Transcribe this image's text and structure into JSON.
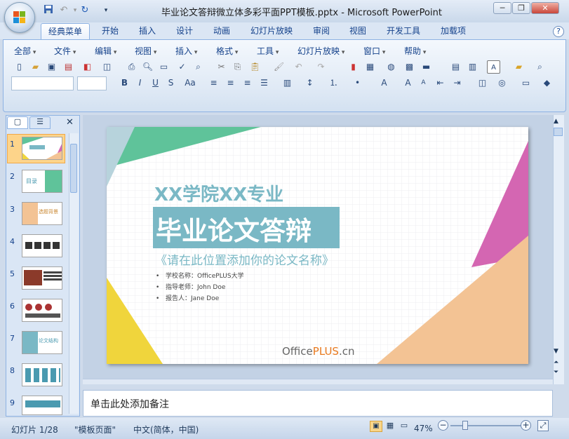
{
  "window": {
    "title": "毕业论文答辩微立体多彩平面PPT模板.pptx - Microsoft PowerPoint"
  },
  "quick_access": {
    "save": "💾",
    "undo": "↶",
    "redo": "↻",
    "more": "▾"
  },
  "tabs": [
    "经典菜单",
    "开始",
    "插入",
    "设计",
    "动画",
    "幻灯片放映",
    "审阅",
    "视图",
    "开发工具",
    "加载项"
  ],
  "menus": [
    "全部",
    "文件",
    "编辑",
    "视图",
    "插入",
    "格式",
    "工具",
    "幻灯片放映",
    "窗口",
    "帮助"
  ],
  "slide": {
    "line1": "XX学院XX专业",
    "line2": "毕业论文答辩",
    "line3": "《请在此位置添加你的论文名称》",
    "bullets": [
      "学校名称：OfficePLUS大学",
      "指导老师：John Doe",
      "报告人：Jane Doe"
    ],
    "logo_a": "Office",
    "logo_b": "PLUS",
    ".cn": ".cn",
    "logo_c": ".cn"
  },
  "thumbs": [
    "1",
    "2",
    "3",
    "4",
    "5",
    "6",
    "7",
    "8",
    "9"
  ],
  "thumb_text": {
    "t2": "目录",
    "t3": "选题背景",
    "t7": "论文结构"
  },
  "notes": {
    "placeholder": "单击此处添加备注"
  },
  "status": {
    "slide": "幻灯片 1/28",
    "theme": "\"模板页面\"",
    "lang": "中文(简体，中国)",
    "zoom": "47%"
  },
  "colors": {
    "teal": "#7ab8c5",
    "green": "#5fc39a",
    "magenta": "#d466b2",
    "peach": "#f3c394",
    "yellow": "#f0d53c"
  }
}
